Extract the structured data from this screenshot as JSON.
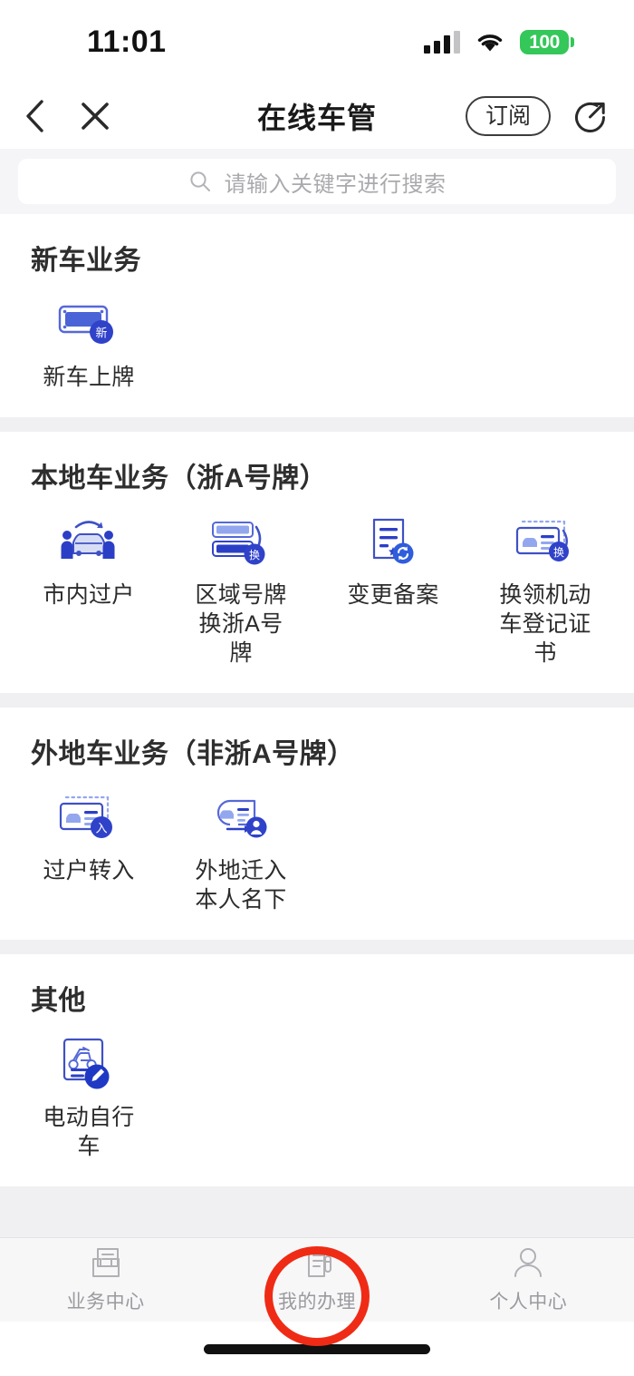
{
  "status_bar": {
    "time": "11:01",
    "battery_level": "100",
    "signal_icon": "signal-bars-icon",
    "wifi_icon": "wifi-icon",
    "battery_color": "#34c759"
  },
  "nav": {
    "back_icon": "back-chevron-icon",
    "close_icon": "close-icon",
    "title": "在线车管",
    "subscribe_label": "订阅",
    "share_icon": "share-icon"
  },
  "search": {
    "placeholder": "请输入关键字进行搜索",
    "icon": "search-icon"
  },
  "sections": [
    {
      "title": "新车业务",
      "items": [
        {
          "label": "新车上牌",
          "icon": "license-plate-new-icon"
        }
      ]
    },
    {
      "title": "本地车业务（浙A号牌）",
      "items": [
        {
          "label": "市内过户",
          "icon": "car-transfer-people-icon"
        },
        {
          "label": "区域号牌\n换浙A号牌",
          "icon": "plate-swap-icon"
        },
        {
          "label": "变更备案",
          "icon": "document-refresh-icon"
        },
        {
          "label": "换领机动\n车登记证\n书",
          "icon": "vehicle-card-swap-icon"
        }
      ]
    },
    {
      "title": "外地车业务（非浙A号牌）",
      "items": [
        {
          "label": "过户转入",
          "icon": "vehicle-card-in-icon"
        },
        {
          "label": "外地迁入\n本人名下",
          "icon": "vehicle-card-person-icon"
        }
      ]
    },
    {
      "title": "其他",
      "items": [
        {
          "label": "电动自行\n车",
          "icon": "ebike-register-icon"
        }
      ]
    }
  ],
  "tabbar": {
    "items": [
      {
        "label": "业务中心",
        "icon": "inbox-tray-icon"
      },
      {
        "label": "我的办理",
        "icon": "document-pen-icon"
      },
      {
        "label": "个人中心",
        "icon": "person-icon"
      }
    ]
  },
  "annotation": {
    "highlight_color": "#ef2b16",
    "highlighted_tab": "我的办理"
  },
  "theme": {
    "primary_blue": "#2b46c8",
    "light_blue": "#93a7ef",
    "page_bg": "#f0f0f2"
  }
}
